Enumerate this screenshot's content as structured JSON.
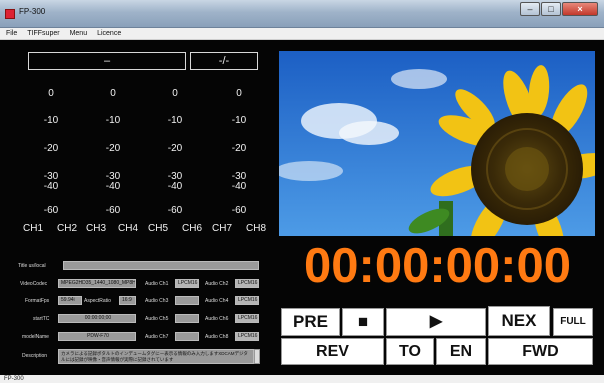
{
  "window": {
    "title": "FP-300"
  },
  "menu": [
    "File",
    "TIFFsuper",
    "Menu",
    "Licence"
  ],
  "meters": {
    "box_left": "–",
    "box_right": "-/-",
    "scale": [
      [
        "0",
        "0",
        "0",
        "0"
      ],
      [
        "-10",
        "-10",
        "-10",
        "-10"
      ],
      [
        "-20",
        "-20",
        "-20",
        "-20"
      ],
      [
        "-30",
        "-30",
        "-30",
        "-30"
      ],
      [
        "-40",
        "-40",
        "-40",
        "-40"
      ],
      [
        "-60",
        "-60",
        "-60",
        "-60"
      ]
    ],
    "channels": [
      "CH1",
      "CH2",
      "CH3",
      "CH4",
      "CH5",
      "CH6",
      "CH7",
      "CH8"
    ]
  },
  "info": {
    "title_label": "Title us/local",
    "title_value": "",
    "videocodec_label": "VideoCodec",
    "videocodec_value": "MPEG2HD35_1440_1080_MP8HL",
    "audio1_label": "Audio Ch1",
    "audio1_value": "LPCM16",
    "audio2_label": "Audio Ch2",
    "audio2_value": "LPCM16",
    "fps_label": "FormatFps",
    "fps_value": "59.94i",
    "aspect_label": "AspectRatio",
    "aspect_value": "16:9",
    "audio3_label": "Audio Ch3",
    "audio3_value": "",
    "audio4_label": "Audio Ch4",
    "audio4_value": "LPCM16",
    "starttc_label": "startTC",
    "starttc_value": "00:00:00;00",
    "audio5_label": "Audio Ch5",
    "audio5_value": "",
    "audio6_label": "Audio Ch6",
    "audio6_value": "LPCM16",
    "model_label": "modelName",
    "model_value": "PDW-F70",
    "audio7_label": "Audio Ch7",
    "audio7_value": "",
    "audio8_label": "Audio Ch8",
    "audio8_value": "LPCM16",
    "desc_label": "Description",
    "desc_value": "カメラによる記録ボタルトのインデュームタグにー表示る情報のみ入力しますXDCAMデジタルには記録が映像・音声情報が実際に記録されています"
  },
  "timecode": "00:00:00:00",
  "controls": {
    "pre": "PRE",
    "stop": "■",
    "play": "▶",
    "nex": "NEX",
    "full": "FULL",
    "rev": "REV",
    "to": "TO",
    "en": "EN",
    "fwd": "FWD"
  },
  "status": "FP-300",
  "colors": {
    "timecode": "#ff7a12",
    "background": "#000000"
  }
}
